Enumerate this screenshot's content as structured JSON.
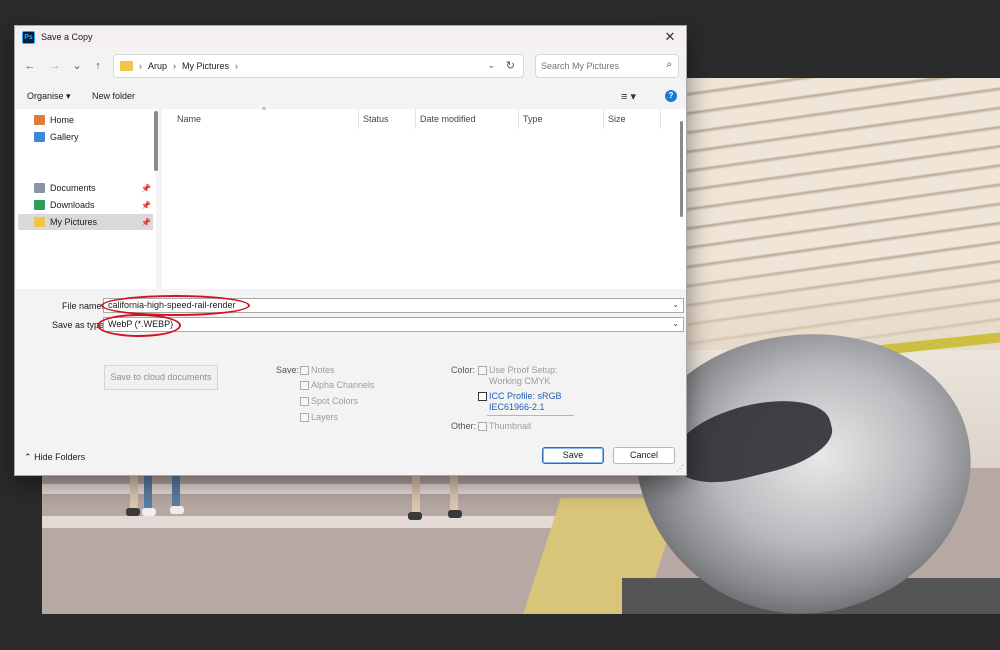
{
  "dialog": {
    "title": "Save a Copy",
    "app_icon_label": "Ps",
    "close_glyph": "✕"
  },
  "nav": {
    "back_glyph": "←",
    "forward_glyph": "→",
    "recent_glyph": "⌄",
    "up_glyph": "↑",
    "breadcrumbs": [
      "Arup",
      "My Pictures"
    ],
    "breadcrumb_sep": "›",
    "address_dropdown_glyph": "⌄",
    "refresh_glyph": "↻",
    "search_placeholder": "Search My Pictures",
    "search_glyph": "⌕"
  },
  "commands": {
    "organise_label": "Organise ▾",
    "new_folder_label": "New folder",
    "view_glyph": "≡ ▾",
    "help_glyph": "?"
  },
  "sidebar": {
    "items": [
      {
        "label": "Home",
        "icon": "home-icon",
        "color": "#e07b3a",
        "pinned": false,
        "selected": false
      },
      {
        "label": "Gallery",
        "icon": "gallery-icon",
        "color": "#3a8ad8",
        "pinned": false,
        "selected": false
      },
      {
        "label": "Documents",
        "icon": "documents-icon",
        "color": "#8a96a8",
        "pinned": true,
        "selected": false
      },
      {
        "label": "Downloads",
        "icon": "downloads-icon",
        "color": "#2e9c5a",
        "pinned": true,
        "selected": false
      },
      {
        "label": "My Pictures",
        "icon": "folder-icon",
        "color": "#f0c64a",
        "pinned": true,
        "selected": true
      }
    ],
    "pin_glyph": "📌"
  },
  "file_list": {
    "columns": [
      "Name",
      "Status",
      "Date modified",
      "Type",
      "Size"
    ],
    "sort_glyph": "^"
  },
  "form": {
    "file_name_label": "File name:",
    "file_name_value": "california-high-speed-rail-render",
    "save_as_type_label": "Save as type:",
    "save_as_type_value": "WebP (*.WEBP)",
    "dropdown_glyph": "⌄",
    "cloud_button_label": "Save to cloud documents"
  },
  "options": {
    "save_label": "Save:",
    "save_options": [
      "Notes",
      "Alpha Channels",
      "Spot Colors",
      "Layers"
    ],
    "color_label": "Color:",
    "proof_setup_line1": "Use Proof Setup:",
    "proof_setup_line2": "Working CMYK",
    "icc_line1": "ICC Profile:  sRGB",
    "icc_line2": "IEC61966-2.1",
    "other_label": "Other:",
    "thumbnail_label": "Thumbnail"
  },
  "footer": {
    "hide_folders_label": "Hide Folders",
    "hide_folders_glyph": "⌃",
    "save_button": "Save",
    "cancel_button": "Cancel"
  },
  "colors": {
    "accent": "#1e7ad6",
    "annotation_red": "#d0121e",
    "selected_nav": "#d9d9d9"
  }
}
